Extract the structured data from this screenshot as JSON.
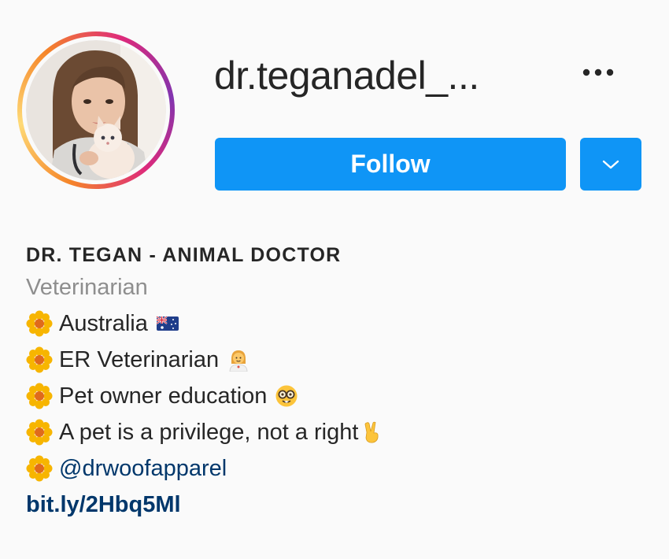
{
  "profile": {
    "username": "dr.teganadel_...",
    "follow_label": "Follow",
    "more_icon": "more-options-icon",
    "dropdown_icon": "chevron-down-icon",
    "avatar_alt": "profile-avatar"
  },
  "bio": {
    "full_name": "DR. TEGAN - ANIMAL DOCTOR",
    "category": "Veterinarian",
    "lines": [
      {
        "text": "Australia",
        "icon": "australia-flag-icon"
      },
      {
        "text": "ER Veterinarian",
        "icon": "health-worker-icon"
      },
      {
        "text": "Pet owner education",
        "icon": "nerd-face-icon"
      },
      {
        "text": "A pet is a privilege, not a right",
        "icon": "victory-hand-icon"
      }
    ],
    "mention": "@drwoofapparel",
    "website": "bit.ly/2Hbq5Ml"
  },
  "colors": {
    "follow_blue": "#0f95f6",
    "link_dark_blue": "#00376b",
    "category_gray": "#8e8e8e",
    "text": "#262626",
    "background": "#fafafa"
  }
}
